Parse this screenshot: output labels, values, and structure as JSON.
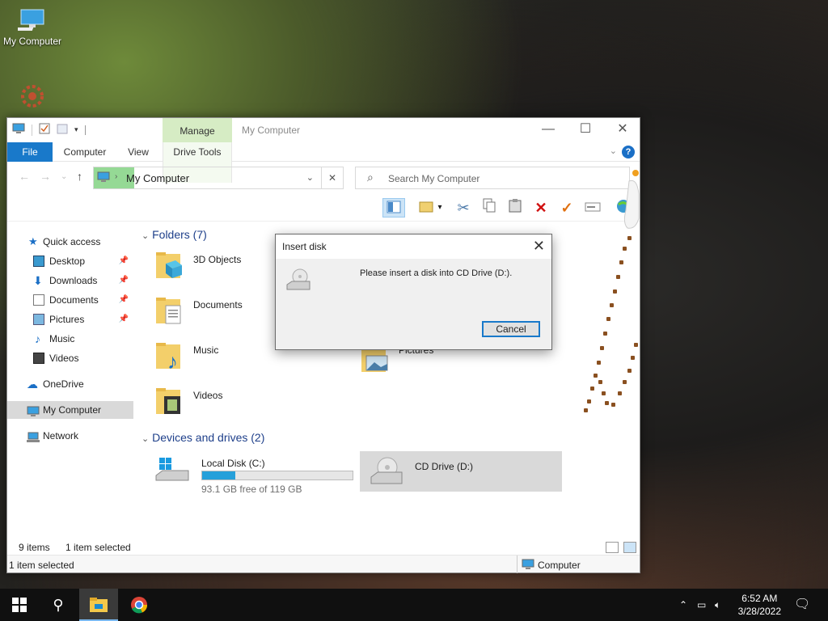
{
  "desktop": {
    "icons": [
      {
        "label": "My Computer",
        "icon": "my-computer-icon"
      }
    ]
  },
  "window": {
    "title": "My Computer",
    "context_tab": "Manage",
    "ribbon_tabs": [
      "File",
      "Computer",
      "View",
      "Drive Tools"
    ],
    "address": "My Computer",
    "search_placeholder": "Search My Computer",
    "nav": {
      "quick_access": "Quick access",
      "quick_items": [
        "Desktop",
        "Downloads",
        "Documents",
        "Pictures",
        "Music",
        "Videos"
      ],
      "onedrive": "OneDrive",
      "my_computer": "My Computer",
      "network": "Network"
    },
    "folders_header": "Folders (7)",
    "folders": [
      "3D Objects",
      "Documents",
      "Music",
      "Videos",
      "Pictures"
    ],
    "devices_header": "Devices and drives (2)",
    "drives": [
      {
        "name": "Local Disk (C:)",
        "free": "93.1 GB free of 119 GB",
        "used_fraction": 0.22
      },
      {
        "name": "CD Drive (D:)"
      }
    ],
    "status": {
      "items": "9 items",
      "selected": "1 item selected"
    },
    "bottom_status": {
      "left": "1 item selected",
      "right": "Computer"
    }
  },
  "dialog": {
    "title": "Insert disk",
    "message": "Please insert a disk into CD Drive (D:).",
    "cancel": "Cancel"
  },
  "taskbar": {
    "time": "6:52 AM",
    "date": "3/28/2022"
  },
  "colors": {
    "accent": "#1979ca",
    "context_tab": "#d6ecc4",
    "progress": "#26a0da"
  }
}
